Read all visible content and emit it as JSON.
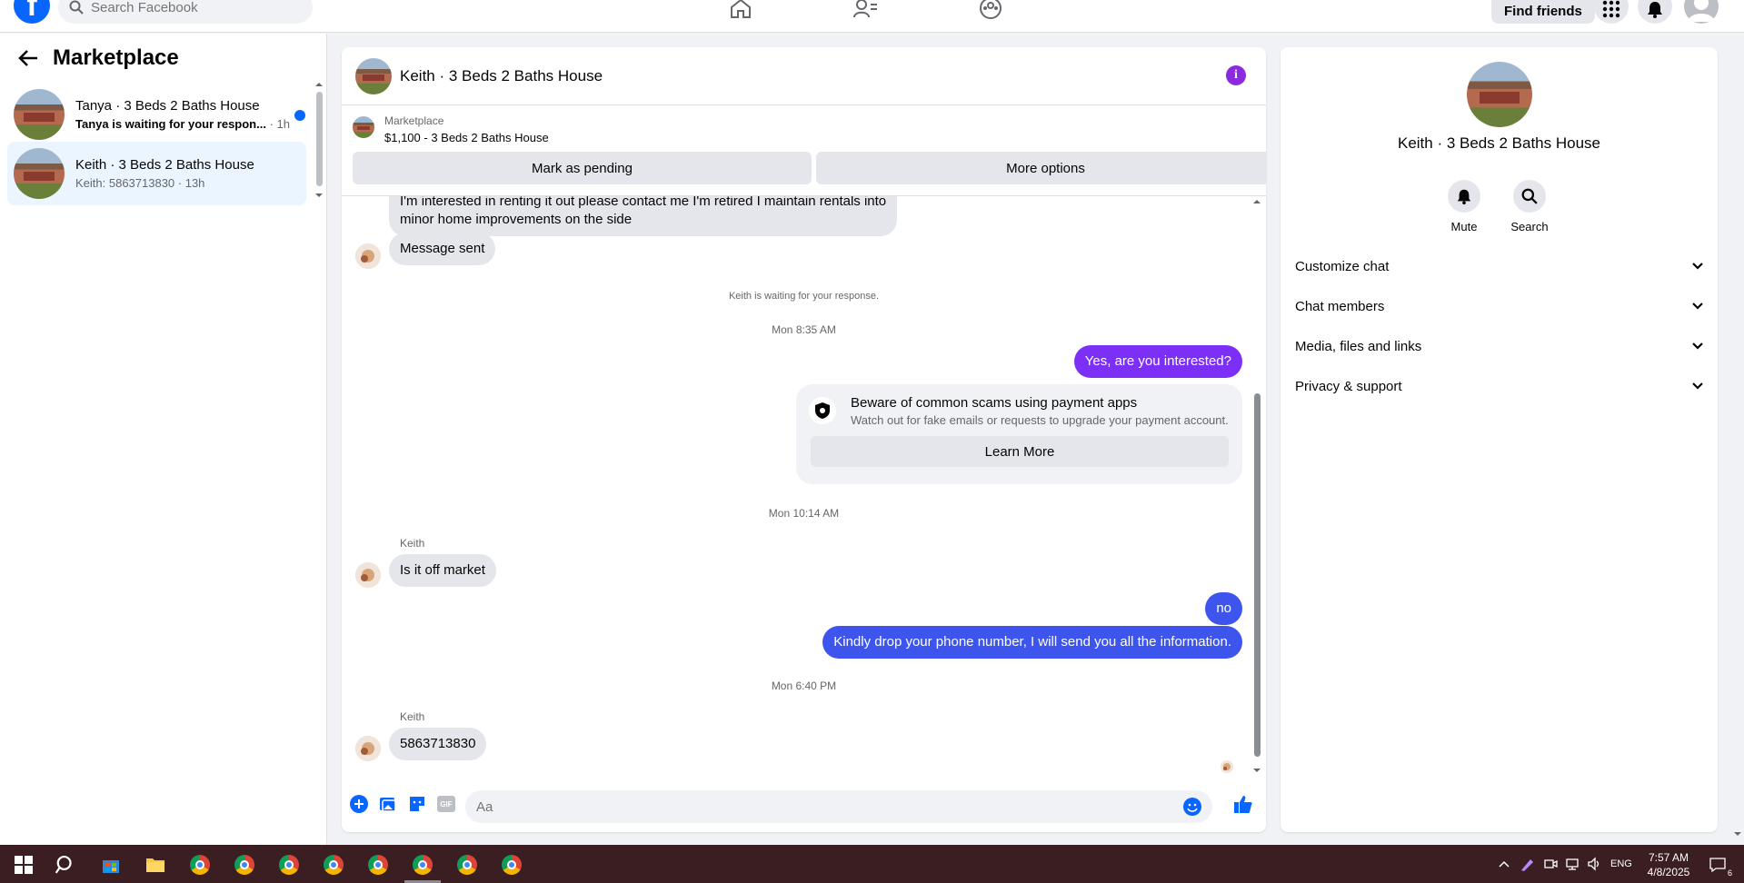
{
  "topbar": {
    "logo": "f",
    "search_placeholder": "Search Facebook",
    "find_friends": "Find friends"
  },
  "left": {
    "title": "Marketplace",
    "conversations": [
      {
        "title": "Tanya · 3 Beds 2 Baths House",
        "preview": "Tanya is waiting for your respon...",
        "time": "· 1h",
        "unread": true
      },
      {
        "title": "Keith · 3 Beds 2 Baths House",
        "preview": "Keith: 5863713830",
        "time": "· 13h",
        "unread": false
      }
    ]
  },
  "chat": {
    "title": "Keith · 3 Beds 2 Baths House",
    "info_glyph": "i",
    "listing_label": "Marketplace",
    "listing_price": "$1,100 - 3 Beds 2 Baths House",
    "mark_pending": "Mark as pending",
    "more_options": "More options",
    "messages": {
      "m1_line1": "I'm interested in renting it out please contact me I'm retired I maintain rentals into",
      "m1_line2": "minor home improvements on the side",
      "m2": "Message sent",
      "waiting": "Keith is waiting for your response.",
      "ts1": "Mon 8:35 AM",
      "m3": "Yes, are you interested?",
      "scam_title": "Beware of common scams using payment apps",
      "scam_desc": "Watch out for fake emails or requests to upgrade your payment account.",
      "learn_more": "Learn More",
      "ts2": "Mon 10:14 AM",
      "sender1": "Keith",
      "m4": "Is it off market",
      "m5": "no",
      "m6": "Kindly drop your phone number, I will send you all the information.",
      "ts3": "Mon 6:40 PM",
      "sender2": "Keith",
      "m7": "5863713830"
    },
    "composer_placeholder": "Aa",
    "gif_label": "GIF"
  },
  "right": {
    "title": "Keith · 3 Beds 2 Baths House",
    "mute": "Mute",
    "search": "Search",
    "rows": [
      "Customize chat",
      "Chat members",
      "Media, files and links",
      "Privacy & support"
    ]
  },
  "taskbar": {
    "lang": "ENG",
    "time": "7:57 AM",
    "date": "4/8/2025",
    "notif_count": "6"
  },
  "colors": {
    "fb_blue": "#0866ff",
    "purple_bubble": "#7b2ff7",
    "blue_bubble": "#3d55ec",
    "taskbar": "#3a1e22"
  }
}
